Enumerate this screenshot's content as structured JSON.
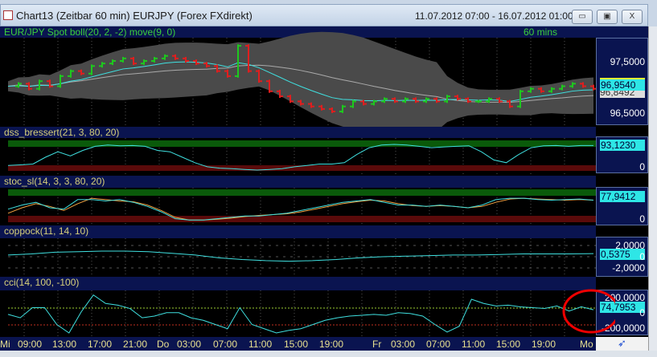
{
  "window": {
    "title": "Chart13 (Zeitbar 60 min)  EURJPY (Forex FXdirekt)",
    "date_range": "11.07.2012 07:00 - 16.07.2012 01:00",
    "buttons": {
      "minimize": "▭",
      "restore": "▣",
      "close": "X"
    }
  },
  "main": {
    "label": "EUR/JPY Spot boll(20, 2, -2) move(9, 0)",
    "interval": "60 mins",
    "axis": {
      "top": "97,5000",
      "bottom": "96,5000",
      "last": "96,9540",
      "ma": "96,8492"
    },
    "closes": [
      97.0,
      97.05,
      96.95,
      97.1,
      97.0,
      97.2,
      97.3,
      97.25,
      97.4,
      97.45,
      97.5,
      97.55,
      97.45,
      97.5,
      97.55,
      97.6,
      97.55,
      97.5,
      97.45,
      97.4,
      97.3,
      97.2,
      97.8,
      97.3,
      97.1,
      96.9,
      96.8,
      96.7,
      96.65,
      96.6,
      96.55,
      96.5,
      96.6,
      96.7,
      96.65,
      96.7,
      96.75,
      96.7,
      96.75,
      96.7,
      96.75,
      96.7,
      96.8,
      96.75,
      96.7,
      96.7,
      96.75,
      96.7,
      96.6,
      96.9,
      96.95,
      96.9,
      96.95,
      97.0,
      97.05,
      97.0,
      96.95
    ]
  },
  "dss": {
    "label": "dss_bressert(21, 3, 80, 20)",
    "axis": {
      "last": "93,1230",
      "zero": "0"
    },
    "values": [
      20,
      22,
      25,
      50,
      70,
      55,
      75,
      90,
      95,
      92,
      93,
      90,
      75,
      70,
      50,
      30,
      15,
      10,
      8,
      5,
      3,
      5,
      8,
      15,
      20,
      25,
      25,
      30,
      60,
      85,
      95,
      97,
      95,
      90,
      85,
      88,
      90,
      92,
      70,
      40,
      30,
      60,
      85,
      92,
      93,
      90,
      93,
      93
    ]
  },
  "stoc": {
    "label": "stoc_sl(14, 3, 3, 80, 20)",
    "axis": {
      "last": "77,9412",
      "zero": "0"
    },
    "k": [
      45,
      60,
      70,
      50,
      45,
      80,
      80,
      75,
      80,
      70,
      55,
      35,
      10,
      5,
      5,
      10,
      15,
      20,
      20,
      25,
      30,
      40,
      50,
      60,
      70,
      75,
      80,
      70,
      60,
      60,
      55,
      60,
      55,
      50,
      60,
      80,
      85,
      85,
      80,
      78,
      80,
      82,
      78
    ],
    "d": [
      30,
      50,
      65,
      55,
      40,
      65,
      85,
      80,
      75,
      72,
      60,
      40,
      15,
      5,
      5,
      8,
      12,
      18,
      22,
      25,
      28,
      35,
      45,
      55,
      65,
      72,
      78,
      75,
      65,
      58,
      55,
      58,
      55,
      50,
      55,
      70,
      82,
      85,
      82,
      80,
      78,
      80,
      78
    ]
  },
  "coppock": {
    "label": "coppock(11, 14, 10)",
    "axis": {
      "top": "2,0000",
      "last": "0,5375",
      "zero": "0",
      "bottom": "-2,0000"
    },
    "values": [
      0.3,
      0.5,
      0.8,
      0.9,
      1.0,
      1.0,
      0.9,
      0.6,
      0.3,
      -0.2,
      -0.5,
      -0.7,
      -0.8,
      -0.7,
      -0.5,
      -0.2,
      0.0,
      0.1,
      0.2,
      0.3,
      0.3,
      0.4,
      0.5,
      0.5,
      0.5,
      0.55
    ]
  },
  "cci": {
    "label": "cci(14, 100, -100)",
    "axis": {
      "top": "200,0000",
      "last": "74,7953",
      "zero": "0",
      "bottom": "-200,0000"
    },
    "values": [
      20,
      -20,
      100,
      100,
      -100,
      -200,
      50,
      250,
      150,
      130,
      90,
      -20,
      0,
      40,
      40,
      -20,
      -50,
      -100,
      -150,
      100,
      -100,
      -150,
      -200,
      -170,
      -150,
      -100,
      -50,
      -20,
      0,
      10,
      20,
      10,
      40,
      30,
      0,
      -100,
      -190,
      -120,
      200,
      150,
      120,
      130,
      110,
      100,
      90,
      120,
      60,
      110,
      75
    ]
  },
  "time_axis": {
    "labels": [
      "Mi",
      "09:00",
      "13:00",
      "17:00",
      "21:00",
      "Do",
      "03:00",
      "07:00",
      "11:00",
      "15:00",
      "19:00",
      "Fr",
      "03:00",
      "07:00",
      "11:00",
      "15:00",
      "19:00",
      "Mo"
    ]
  },
  "colors": {
    "bull": "#1ec81e",
    "bear": "#e01e1e",
    "line": "#3fe0e0",
    "orange": "#f0a040",
    "band": "#4a4a4a"
  }
}
